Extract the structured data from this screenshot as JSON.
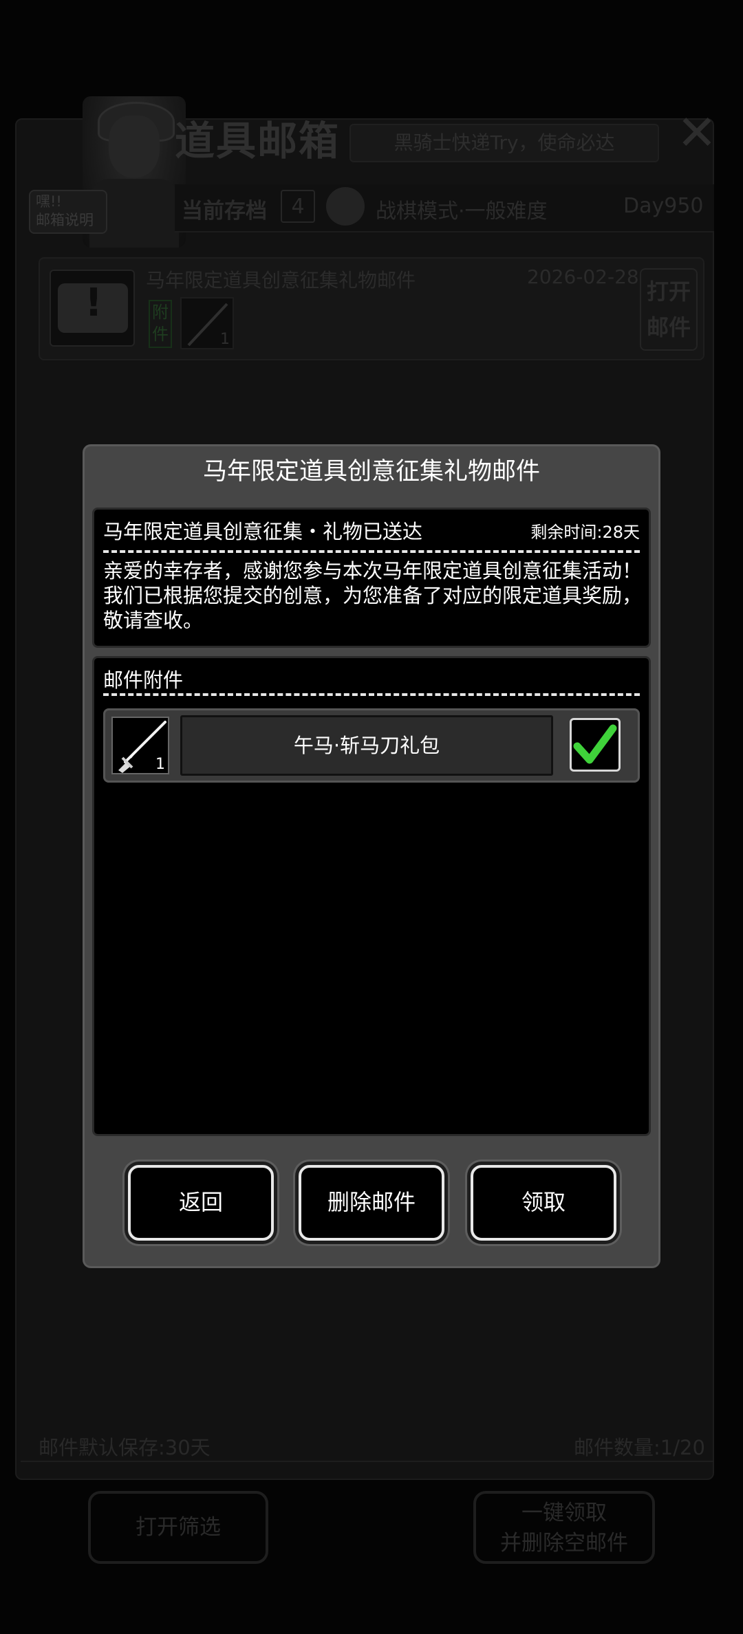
{
  "background": {
    "hey_bubble": [
      "嘿!!",
      "邮箱说明"
    ],
    "title": "道具邮箱",
    "slogan": "黑骑士快递Try，使命必达",
    "close_icon": "✕",
    "current_save_label": "当前存档",
    "current_save_number": "4",
    "mode": "战棋模式·一般难度",
    "day": "Day950",
    "mail_item": {
      "subject": "马年限定道具创意征集礼物邮件",
      "date": "2026-02-28",
      "attach_tag": [
        "附",
        "件"
      ],
      "item_count": "1",
      "open_label": [
        "打开",
        "邮件"
      ]
    },
    "footer_left": "邮件默认保存:30天",
    "footer_right": "邮件数量:1/20",
    "filter_button": "打开筛选",
    "claim_all_button": [
      "一键领取",
      "并删除空邮件"
    ]
  },
  "dialog": {
    "title": "马年限定道具创意征集礼物邮件",
    "message_heading": "马年限定道具创意征集・礼物已送达",
    "time_left": "剩余时间:28天",
    "message_body": "亲爱的幸存者，感谢您参与本次马年限定道具创意征集活动！我们已根据您提交的创意，为您准备了对应的限定道具奖励，敬请查收。",
    "attachments_heading": "邮件附件",
    "attachment": {
      "name": "午马·斩马刀礼包",
      "count": "1",
      "checked": true
    },
    "buttons": {
      "back": "返回",
      "delete": "删除邮件",
      "claim": "领取"
    }
  },
  "colors": {
    "dialog_bg": "#464646",
    "check_green": "#3fd23a",
    "button_border": "#e8e8e8"
  }
}
